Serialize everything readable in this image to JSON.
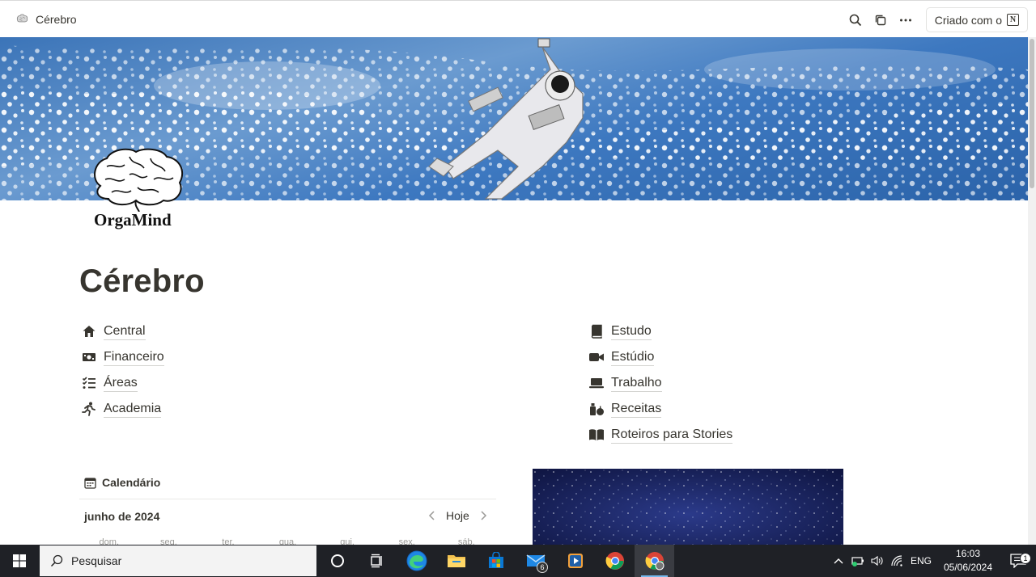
{
  "topbar": {
    "breadcrumb": "Cérebro",
    "made_with": "Criado com o",
    "notion_glyph": "N"
  },
  "page": {
    "brand": "OrgaMind",
    "title": "Cérebro"
  },
  "links_left": [
    {
      "label": "Central",
      "icon": "home-icon"
    },
    {
      "label": "Financeiro",
      "icon": "money-icon"
    },
    {
      "label": "Áreas",
      "icon": "checklist-icon"
    },
    {
      "label": "Academia",
      "icon": "running-icon"
    }
  ],
  "links_right": [
    {
      "label": "Estudo",
      "icon": "book-icon"
    },
    {
      "label": "Estúdio",
      "icon": "video-icon"
    },
    {
      "label": "Trabalho",
      "icon": "laptop-icon"
    },
    {
      "label": "Receitas",
      "icon": "food-icon"
    },
    {
      "label": "Roteiros para Stories",
      "icon": "open-book-icon"
    }
  ],
  "calendar": {
    "title": "Calendário",
    "month": "junho de 2024",
    "today": "Hoje",
    "weekdays": [
      "dom.",
      "seg.",
      "ter.",
      "qua.",
      "qui.",
      "sex.",
      "sáb."
    ]
  },
  "taskbar": {
    "search_placeholder": "Pesquisar",
    "mail_badge": "6",
    "language": "ENG",
    "time": "16:03",
    "date": "05/06/2024",
    "notifications": "1"
  }
}
